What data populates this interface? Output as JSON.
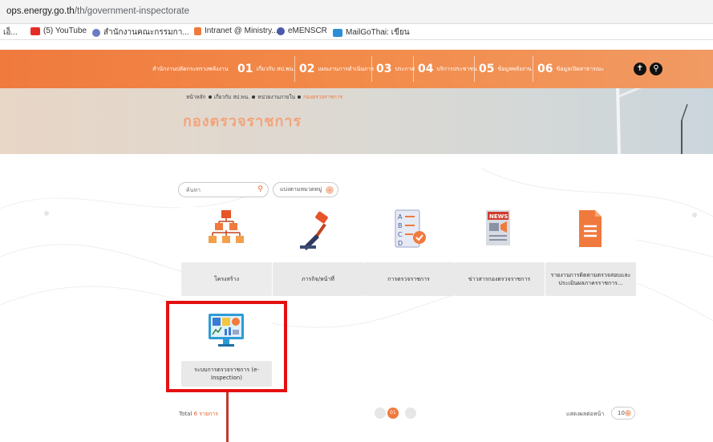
{
  "browser": {
    "url_host": "ops.energy.go.th",
    "url_path": "/th/government-inspectorate",
    "bookmarks": [
      {
        "label": "เอ็...",
        "icon": "generic-icon"
      },
      {
        "label": "(5) YouTube",
        "icon": "youtube-icon"
      },
      {
        "label": "สำนักงานคณะกรรมกา...",
        "icon": "globe-icon"
      },
      {
        "label": "Intranet @ Ministry...",
        "icon": "flame-icon"
      },
      {
        "label": "eMENSCR",
        "icon": "globe-icon"
      },
      {
        "label": "MailGoThai: เขียน",
        "icon": "mail-icon"
      }
    ]
  },
  "header": {
    "logo_text": "สำนักงานปลัดกระทรวงพลังงาน",
    "nav": [
      {
        "num": "01",
        "label": "เกี่ยวกับ สป.พน."
      },
      {
        "num": "02",
        "label": "แผนงานการดำเนินการ"
      },
      {
        "num": "03",
        "label": "ประกาศ"
      },
      {
        "num": "04",
        "label": "บริการประชาชน"
      },
      {
        "num": "05",
        "label": "ข้อมูลพลังงาน"
      },
      {
        "num": "06",
        "label": "ข้อมูลเปิดสาธารณะ"
      }
    ],
    "accessibility_glyph": "✝",
    "search_glyph": "⚲"
  },
  "hero": {
    "breadcrumb": [
      "หน้าหลัก",
      "เกี่ยวกับ สป.พน.",
      "หน่วยงานภายใน",
      "กองตรวจราชการ"
    ],
    "title": "กองตรวจราชการ"
  },
  "filters": {
    "search_placeholder": "ค้นหา",
    "category_label": "แบ่งตามหมวดหมู่",
    "chevron": "⌄"
  },
  "cards": [
    {
      "label": "โครงสร้าง",
      "icon": "org-chart-icon"
    },
    {
      "label": "ภารกิจ/หน้าที่",
      "icon": "gavel-icon"
    },
    {
      "label": "การตรวจราชการ",
      "icon": "checklist-icon"
    },
    {
      "label": "ข่าวสารกองตรวจราชการ",
      "icon": "news-icon"
    },
    {
      "label": "รายงานการติดตามตรวจสอบและประเมินผลภาครราชการ...",
      "icon": "document-icon"
    },
    {
      "label": "ระบบการตรวจราชการ (e-Inspection)",
      "icon": "dashboard-monitor-icon"
    }
  ],
  "pagination": {
    "total_prefix": "Total",
    "total_value": "6 รายการ",
    "current_page": "01",
    "per_page_label": "แสดงผลต่อหน้า",
    "per_page_value": "10"
  },
  "colors": {
    "brand_orange": "#f07a3e",
    "highlight_red": "#e41010"
  }
}
